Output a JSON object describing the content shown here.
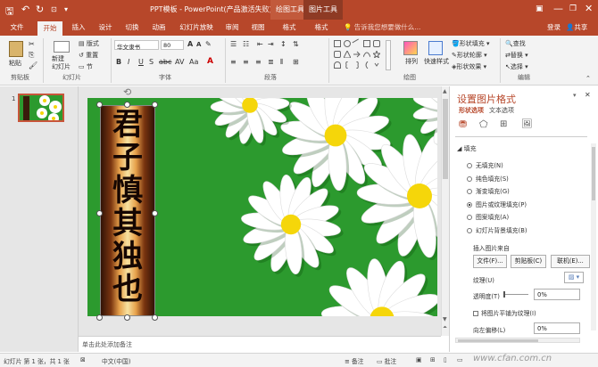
{
  "titlebar": {
    "title": "PPT模板 - PowerPoint(产品激活失败)",
    "context_drawing_tools": "绘图工具",
    "context_picture_tools": "图片工具"
  },
  "tabs": [
    "文件",
    "开始",
    "插入",
    "设计",
    "切换",
    "动画",
    "幻灯片放映",
    "审阅",
    "视图",
    "格式",
    "格式"
  ],
  "tell_me": "告诉我您想要做什么...",
  "login": "登录",
  "share": "共享",
  "ribbon": {
    "paste": "粘贴",
    "new_slide": "新建\n幻灯片",
    "layout": "版式",
    "reset": "重置",
    "section": "节",
    "font_name": "华文隶书",
    "font_size": "80",
    "arrange": "排列",
    "quick_styles": "快速样式",
    "shape_fill": "形状填充",
    "shape_outline": "形状轮廓",
    "shape_effects": "形状效果",
    "find": "查找",
    "replace": "替换",
    "select": "选择",
    "groups": {
      "clipboard": "剪贴板",
      "slides": "幻灯片",
      "font": "字体",
      "paragraph": "段落",
      "drawing": "绘图",
      "editing": "编辑"
    }
  },
  "thumb": {
    "number": "1"
  },
  "slide": {
    "vertical_text": [
      "君",
      "子",
      "慎",
      "其",
      "独",
      "也"
    ],
    "colors": {
      "bg": "#2c9a2e",
      "petal": "#ffffff",
      "center": "#f5d60a"
    }
  },
  "notes_placeholder": "单击此处添加备注",
  "format_pane": {
    "title": "设置图片格式",
    "tab_shape": "形状选项",
    "tab_text": "文本选项",
    "fill_section": "填充",
    "options": [
      "无填充(N)",
      "纯色填充(S)",
      "渐变填充(G)",
      "图片或纹理填充(P)",
      "图案填充(A)",
      "幻灯片背景填充(B)"
    ],
    "selected_option": 3,
    "insert_from": "插入图片来自",
    "btn_file": "文件(F)...",
    "btn_clipboard": "剪贴板(C)",
    "btn_online": "联机(E)...",
    "texture": "纹理(U)",
    "transparency": "透明度(T)",
    "transparency_value": "0%",
    "tile_picture": "将图片平铺为纹理(I)",
    "offset_left": "向左偏移(L)",
    "offset_left_value": "0%"
  },
  "status": {
    "slide_info": "幻灯片 第 1 张，共 1 张",
    "language": "中文(中国)",
    "notes": "备注",
    "comments": "批注",
    "watermark": "www.cfan.com.cn"
  }
}
